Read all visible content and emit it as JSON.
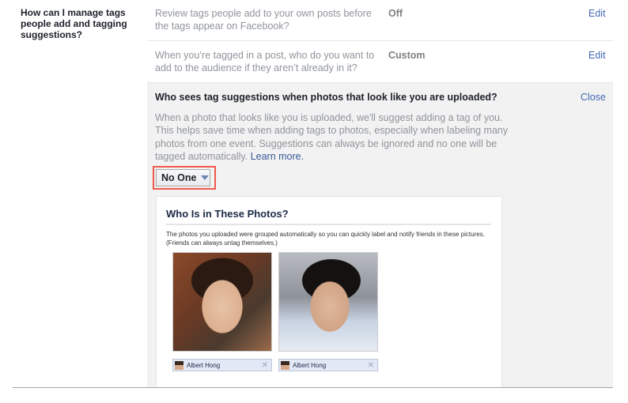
{
  "section": {
    "label": "How can I manage tags people add and tagging suggestions?"
  },
  "rows": [
    {
      "description": "Review tags people add to your own posts before the tags appear on Facebook?",
      "value": "Off",
      "action": "Edit"
    },
    {
      "description": "When you’re tagged in a post, who do you want to add to the audience if they aren’t already in it?",
      "value": "Custom",
      "action": "Edit"
    }
  ],
  "expanded": {
    "title": "Who sees tag suggestions when photos that look like you are uploaded?",
    "close": "Close",
    "description": "When a photo that looks like you is uploaded, we'll suggest adding a tag of you. This helps save time when adding tags to photos, especially when labeling many photos from one event. Suggestions can always be ignored and no one will be tagged automatically.",
    "learn_more": "Learn more.",
    "dropdown": {
      "selected": "No One",
      "icon": "chevron-down-icon"
    },
    "preview": {
      "title": "Who Is in These Photos?",
      "description": "The photos you uploaded were grouped automatically so you can quickly label and notify friends in these pictures. (Friends can always untag themselves.)",
      "photos": [
        {
          "alt": "Photo of Albert Hong",
          "tag": "Albert Hong",
          "remove_icon": "close-icon"
        },
        {
          "alt": "Photo of Albert Hong",
          "tag": "Albert Hong",
          "remove_icon": "close-icon"
        }
      ]
    }
  },
  "colors": {
    "link": "#4267b2",
    "highlight": "#f0584e",
    "panel_bg": "#f2f2f2"
  }
}
